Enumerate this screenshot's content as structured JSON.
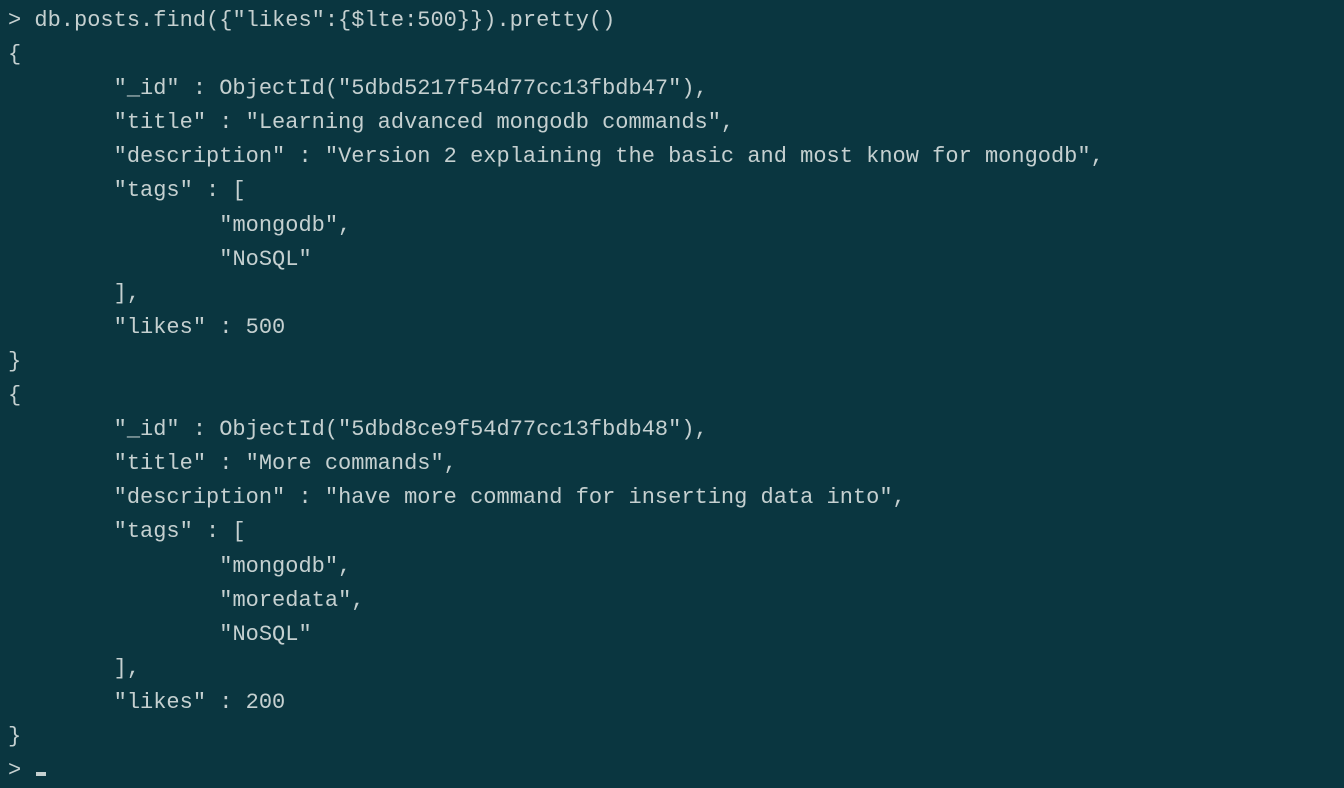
{
  "terminal": {
    "prompt_symbol": ">",
    "command": "db.posts.find({\"likes\":{$lte:500}}).pretty()",
    "results": [
      {
        "_id": "5dbd5217f54d77cc13fbdb47",
        "title": "Learning advanced mongodb commands",
        "description": "Version 2 explaining the basic and most know for mongodb",
        "tags": [
          "mongodb",
          "NoSQL"
        ],
        "likes": 500
      },
      {
        "_id": "5dbd8ce9f54d77cc13fbdb48",
        "title": "More commands",
        "description": "have more command for inserting data into",
        "tags": [
          "mongodb",
          "moredata",
          "NoSQL"
        ],
        "likes": 200
      }
    ]
  }
}
